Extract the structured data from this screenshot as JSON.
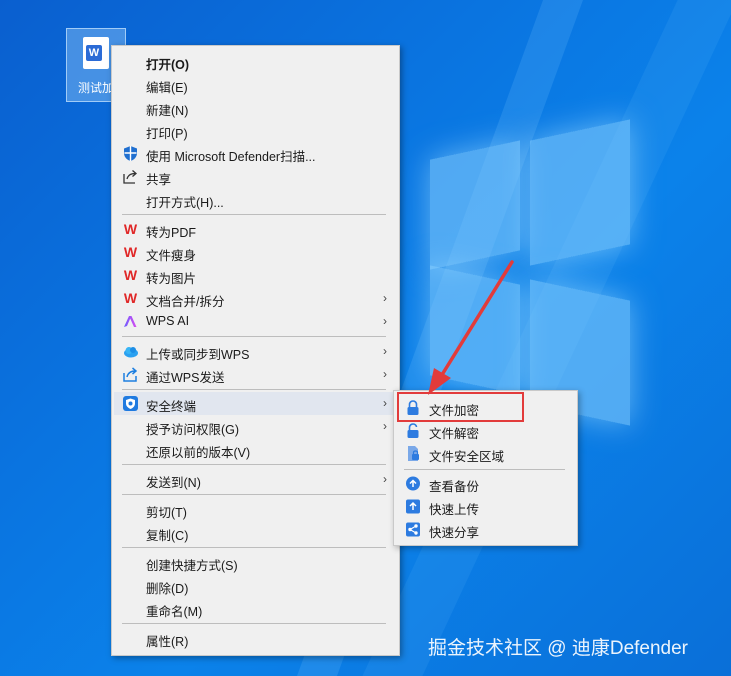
{
  "desktop": {
    "file_label": "测试加",
    "file_icon_letter": "W"
  },
  "menu": {
    "items": [
      {
        "label": "打开(O)"
      },
      {
        "label": "编辑(E)"
      },
      {
        "label": "新建(N)"
      },
      {
        "label": "打印(P)"
      },
      {
        "label": "使用 Microsoft Defender扫描..."
      },
      {
        "label": "共享"
      },
      {
        "label": "打开方式(H)..."
      },
      {
        "label": "转为PDF"
      },
      {
        "label": "文件瘦身"
      },
      {
        "label": "转为图片"
      },
      {
        "label": "文档合并/拆分"
      },
      {
        "label": "WPS AI"
      },
      {
        "label": "上传或同步到WPS"
      },
      {
        "label": "通过WPS发送"
      },
      {
        "label": "安全终端"
      },
      {
        "label": "授予访问权限(G)"
      },
      {
        "label": "还原以前的版本(V)"
      },
      {
        "label": "发送到(N)"
      },
      {
        "label": "剪切(T)"
      },
      {
        "label": "复制(C)"
      },
      {
        "label": "创建快捷方式(S)"
      },
      {
        "label": "删除(D)"
      },
      {
        "label": "重命名(M)"
      },
      {
        "label": "属性(R)"
      }
    ],
    "submenu_arrow": "›"
  },
  "submenu": {
    "items": [
      {
        "label": "文件加密"
      },
      {
        "label": "文件解密"
      },
      {
        "label": "文件安全区域"
      },
      {
        "label": "查看备份"
      },
      {
        "label": "快速上传"
      },
      {
        "label": "快速分享"
      }
    ]
  },
  "watermark": "掘金技术社区 @ 迪康Defender",
  "colors": {
    "accent": "#e23b3b",
    "wps_red": "#e02828",
    "desktop_blue": "#0a74e0"
  }
}
